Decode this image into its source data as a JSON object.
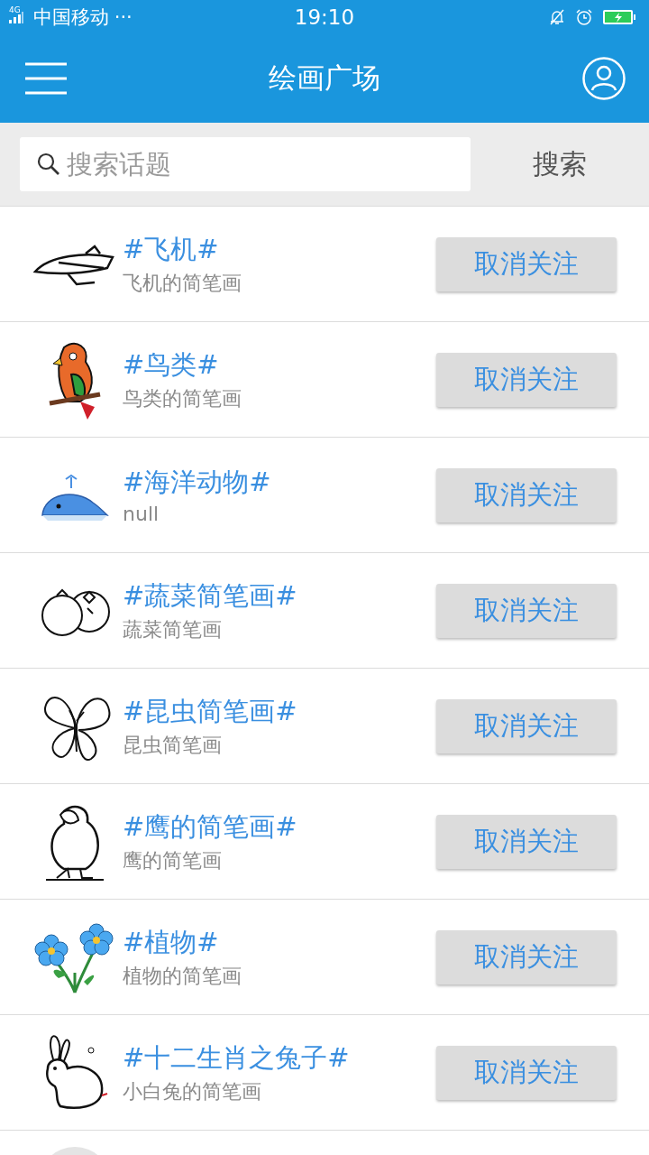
{
  "status_bar": {
    "network": "4G",
    "carrier": "中国移动",
    "more": "···",
    "time": "19:10"
  },
  "header": {
    "title": "绘画广场"
  },
  "search": {
    "placeholder": "搜索话题",
    "button": "搜索"
  },
  "topics": [
    {
      "kind": "airplane",
      "title": "#飞机#",
      "subtitle": "飞机的简笔画",
      "action": "取消关注"
    },
    {
      "kind": "parrot",
      "title": "#鸟类#",
      "subtitle": "鸟类的简笔画",
      "action": "取消关注"
    },
    {
      "kind": "whale",
      "title": "#海洋动物#",
      "subtitle": "null",
      "action": "取消关注"
    },
    {
      "kind": "vegetables",
      "title": "#蔬菜简笔画#",
      "subtitle": "蔬菜简笔画",
      "action": "取消关注"
    },
    {
      "kind": "butterfly",
      "title": "#昆虫简笔画#",
      "subtitle": "昆虫简笔画",
      "action": "取消关注"
    },
    {
      "kind": "bird",
      "title": "#鹰的简笔画#",
      "subtitle": "鹰的简笔画",
      "action": "取消关注"
    },
    {
      "kind": "flowers",
      "title": "#植物#",
      "subtitle": "植物的简笔画",
      "action": "取消关注"
    },
    {
      "kind": "rabbit",
      "title": "#十二生肖之兔子#",
      "subtitle": "小白兔的简笔画",
      "action": "取消关注"
    },
    {
      "kind": "blank"
    }
  ]
}
